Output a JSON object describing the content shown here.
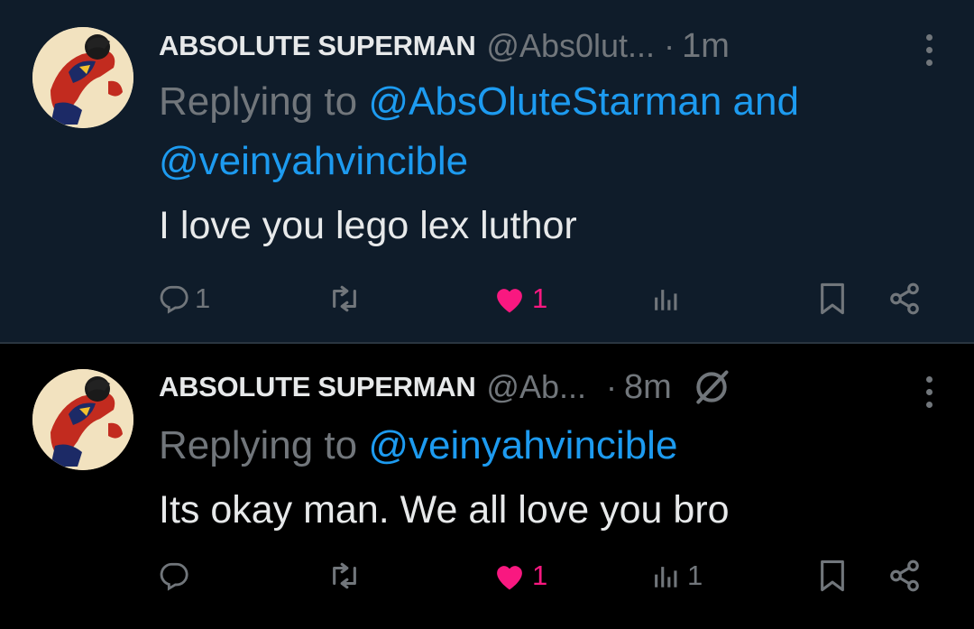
{
  "tweets": [
    {
      "author_name": "ABSOLUTE SUPERMAN",
      "handle": "@Abs0lut...",
      "separator": "·",
      "time": "1m",
      "replying_prefix": "Replying to ",
      "replying_mention_1": "@AbsOluteStarman",
      "replying_joiner": " and",
      "replying_mention_2": "@veinyahvincible",
      "text": "I love you lego lex luthor",
      "reply_count": "1",
      "retweet_count": "",
      "like_count": "1",
      "view_count": "",
      "liked": true
    },
    {
      "author_name": "ABSOLUTE SUPERMAN",
      "handle": "@Ab...",
      "separator": "·",
      "time": "8m",
      "replying_prefix": "Replying to ",
      "replying_mention_1": "@veinyahvincible",
      "text": "Its okay man. We all love you bro",
      "reply_count": "",
      "retweet_count": "",
      "like_count": "1",
      "view_count": "1",
      "liked": true
    }
  ],
  "colors": {
    "background_top": "#0f1c2a",
    "background_bottom": "#000000",
    "text_primary": "#e7e9ea",
    "text_secondary": "#71767b",
    "mention": "#1d9bf0",
    "like": "#f91880"
  },
  "icons": [
    "reply-icon",
    "retweet-icon",
    "like-icon",
    "views-icon",
    "bookmark-icon",
    "share-icon",
    "more-icon",
    "no-entry-icon",
    "avatar-superman"
  ]
}
